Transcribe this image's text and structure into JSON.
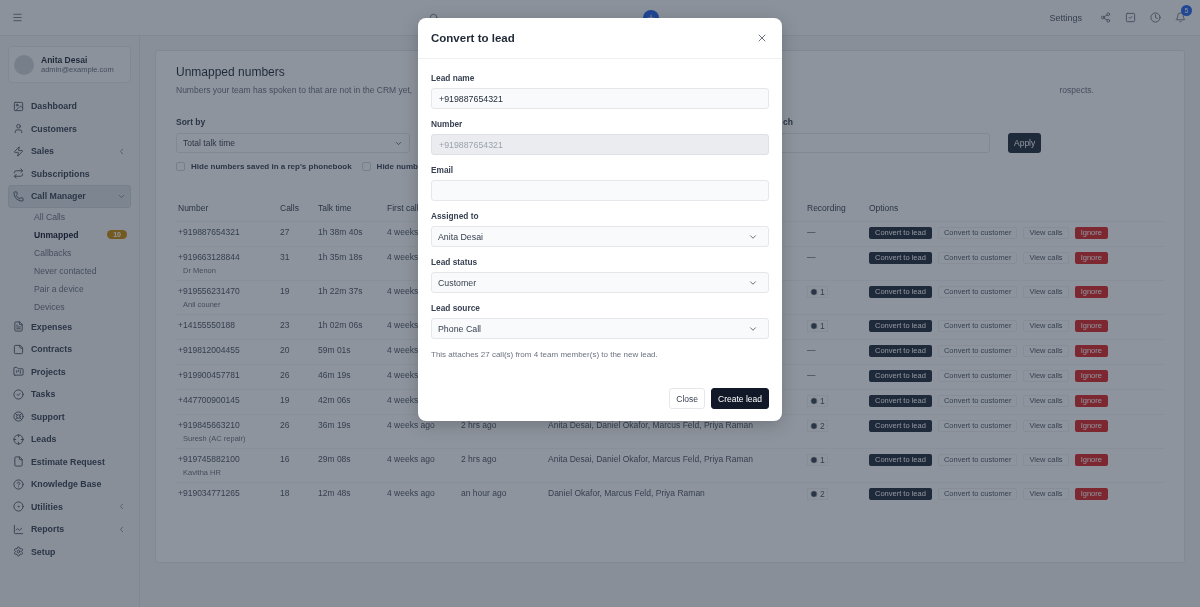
{
  "topbar": {
    "settings_label": "Settings",
    "notification_count": "5"
  },
  "sidebar": {
    "user": {
      "name": "Anita Desai",
      "email": "admin@example.com"
    },
    "items": [
      {
        "label": "Dashboard",
        "selected": false
      },
      {
        "label": "Customers",
        "selected": false
      },
      {
        "label": "Sales",
        "selected": false,
        "expanded": false
      },
      {
        "label": "Subscriptions",
        "selected": false
      },
      {
        "label": "Call Manager",
        "selected": true,
        "expanded": true,
        "children": [
          {
            "label": "All Calls",
            "selected": false
          },
          {
            "label": "Unmapped",
            "selected": true,
            "badge": "10"
          },
          {
            "label": "Callbacks",
            "selected": false
          },
          {
            "label": "Never contacted",
            "selected": false
          },
          {
            "label": "Pair a device",
            "selected": false
          },
          {
            "label": "Devices",
            "selected": false
          }
        ]
      },
      {
        "label": "Expenses",
        "selected": false
      },
      {
        "label": "Contracts",
        "selected": false
      },
      {
        "label": "Projects",
        "selected": false
      },
      {
        "label": "Tasks",
        "selected": false
      },
      {
        "label": "Support",
        "selected": false
      },
      {
        "label": "Leads",
        "selected": false
      },
      {
        "label": "Estimate Request",
        "selected": false
      },
      {
        "label": "Knowledge Base",
        "selected": false
      },
      {
        "label": "Utilities",
        "selected": false,
        "expanded": false
      },
      {
        "label": "Reports",
        "selected": false,
        "expanded": false
      },
      {
        "label": "Setup",
        "selected": false
      }
    ]
  },
  "page": {
    "title": "Unmapped numbers",
    "description": "Numbers your team has spoken to that are not in the CRM yet,",
    "description_tail": "rospects.",
    "sort": {
      "label": "Sort by",
      "value": "Total talk time"
    },
    "search": {
      "label": "ch"
    },
    "apply_label": "Apply",
    "checkboxes": [
      {
        "label": "Hide numbers saved in a rep's phonebook",
        "checked": false
      },
      {
        "label": "Hide numb",
        "checked": false
      }
    ]
  },
  "table": {
    "columns": [
      "Number",
      "Calls",
      "Talk time",
      "First call",
      "",
      "",
      "Recording",
      "Options"
    ],
    "rows": [
      {
        "number": "+919887654321",
        "calls": "27",
        "talk_time": "1h 38m 40s",
        "first_call": "4 weeks",
        "recording": {
          "kind": "dash",
          "text": "—"
        },
        "actions": [
          {
            "kind": "primary",
            "label": "Convert to lead"
          },
          {
            "kind": "plain",
            "label": "Convert to customer"
          },
          {
            "kind": "plain",
            "label": "View calls"
          },
          {
            "kind": "danger",
            "label": "Ignore"
          }
        ]
      },
      {
        "number": "+919663128844",
        "name": "Dr Menon",
        "calls": "31",
        "talk_time": "1h 35m 18s",
        "first_call": "4 weeks",
        "recording": {
          "kind": "dash",
          "text": "—"
        },
        "actions": [
          {
            "kind": "primary",
            "label": "Convert to lead"
          },
          {
            "kind": "plain",
            "label": "Convert to customer"
          },
          {
            "kind": "plain",
            "label": "View calls"
          },
          {
            "kind": "danger",
            "label": "Ignore"
          }
        ]
      },
      {
        "number": "+919556231470",
        "name": "Anil couner",
        "calls": "19",
        "talk_time": "1h 22m 37s",
        "first_call": "4 weeks",
        "recording": {
          "kind": "play",
          "text": "1"
        },
        "actions": [
          {
            "kind": "primary",
            "label": "Convert to lead"
          },
          {
            "kind": "plain",
            "label": "Convert to customer"
          },
          {
            "kind": "plain",
            "label": "View calls"
          },
          {
            "kind": "danger",
            "label": "Ignore"
          }
        ]
      },
      {
        "number": "+14155550188",
        "calls": "23",
        "talk_time": "1h 02m 06s",
        "first_call": "4 weeks",
        "recording": {
          "kind": "play",
          "text": "1"
        },
        "actions": [
          {
            "kind": "primary",
            "label": "Convert to lead"
          },
          {
            "kind": "plain",
            "label": "Convert to customer"
          },
          {
            "kind": "plain",
            "label": "View calls"
          },
          {
            "kind": "danger",
            "label": "Ignore"
          }
        ]
      },
      {
        "number": "+919812004455",
        "calls": "20",
        "talk_time": "59m 01s",
        "first_call": "4 weeks",
        "recording": {
          "kind": "dash",
          "text": "—"
        },
        "actions": [
          {
            "kind": "primary",
            "label": "Convert to lead"
          },
          {
            "kind": "plain",
            "label": "Convert to customer"
          },
          {
            "kind": "plain",
            "label": "View calls"
          },
          {
            "kind": "danger",
            "label": "Ignore"
          }
        ]
      },
      {
        "number": "+919900457781",
        "calls": "26",
        "talk_time": "46m 19s",
        "first_call": "4 weeks",
        "recording": {
          "kind": "dash",
          "text": "—"
        },
        "actions": [
          {
            "kind": "primary",
            "label": "Convert to lead"
          },
          {
            "kind": "plain",
            "label": "Convert to customer"
          },
          {
            "kind": "plain",
            "label": "View calls"
          },
          {
            "kind": "danger",
            "label": "Ignore"
          }
        ]
      },
      {
        "number": "+447700900145",
        "calls": "19",
        "talk_time": "42m 06s",
        "first_call": "4 weeks",
        "recording": {
          "kind": "play",
          "text": "1"
        },
        "actions": [
          {
            "kind": "primary",
            "label": "Convert to lead"
          },
          {
            "kind": "plain",
            "label": "Convert to customer"
          },
          {
            "kind": "plain",
            "label": "View calls"
          },
          {
            "kind": "danger",
            "label": "Ignore"
          }
        ]
      },
      {
        "number": "+919845663210",
        "name": "Suresh (AC repair)",
        "calls": "26",
        "talk_time": "36m 19s",
        "first_call": "4 weeks ago",
        "last_call": "2 hrs ago",
        "reps": "Anita Desai, Daniel Okafor, Marcus Feld, Priya Raman",
        "recording": {
          "kind": "play",
          "text": "2"
        },
        "actions": [
          {
            "kind": "primary",
            "label": "Convert to lead"
          },
          {
            "kind": "plain",
            "label": "Convert to customer"
          },
          {
            "kind": "plain",
            "label": "View calls"
          },
          {
            "kind": "danger",
            "label": "Ignore"
          }
        ]
      },
      {
        "number": "+919745882100",
        "name": "Kavitha HR",
        "calls": "16",
        "talk_time": "29m 08s",
        "first_call": "4 weeks ago",
        "last_call": "2 hrs ago",
        "reps": "Anita Desai, Daniel Okafor, Marcus Feld, Priya Raman",
        "recording": {
          "kind": "play",
          "text": "1"
        },
        "actions": [
          {
            "kind": "primary",
            "label": "Convert to lead"
          },
          {
            "kind": "plain",
            "label": "Convert to customer"
          },
          {
            "kind": "plain",
            "label": "View calls"
          },
          {
            "kind": "danger",
            "label": "Ignore"
          }
        ]
      },
      {
        "number": "+919034771265",
        "calls": "18",
        "talk_time": "12m 48s",
        "first_call": "4 weeks ago",
        "last_call": "an hour ago",
        "reps": "Daniel Okafor, Marcus Feld, Priya Raman",
        "recording": {
          "kind": "play",
          "text": "2"
        },
        "actions": [
          {
            "kind": "primary",
            "label": "Convert to lead"
          },
          {
            "kind": "plain",
            "label": "Convert to customer"
          },
          {
            "kind": "plain",
            "label": "View calls"
          },
          {
            "kind": "danger",
            "label": "Ignore"
          }
        ]
      }
    ]
  },
  "modal": {
    "title": "Convert to lead",
    "fields": [
      {
        "kind": "text",
        "label": "Lead name",
        "value": "+919887654321",
        "disabled": false
      },
      {
        "kind": "text",
        "label": "Number",
        "value": "+919887654321",
        "disabled": true
      },
      {
        "kind": "text",
        "label": "Email",
        "disabled": false
      },
      {
        "kind": "select",
        "label": "Assigned to",
        "value": "Anita Desai"
      },
      {
        "kind": "select",
        "label": "Lead status",
        "value": "Customer"
      },
      {
        "kind": "select",
        "label": "Lead source",
        "value": "Phone Call"
      }
    ],
    "note": "This attaches 27 call(s) from 4 team member(s) to the new lead.",
    "buttons": [
      {
        "kind": "secondary",
        "label": "Close"
      },
      {
        "kind": "primary",
        "label": "Create lead"
      }
    ]
  }
}
